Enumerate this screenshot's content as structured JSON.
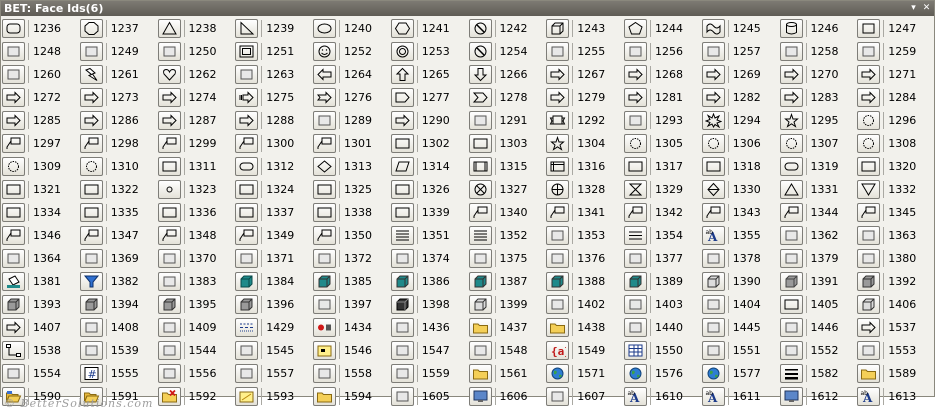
{
  "window": {
    "title": "BET: Face Ids(6)",
    "dropdown_glyph": "▾",
    "close_glyph": "✕"
  },
  "face_ids": [
    1236,
    1237,
    1238,
    1239,
    1240,
    1241,
    1242,
    1243,
    1244,
    1245,
    1246,
    1247,
    1248,
    1249,
    1250,
    1251,
    1252,
    1253,
    1254,
    1255,
    1256,
    1257,
    1258,
    1259,
    1260,
    1261,
    1262,
    1263,
    1264,
    1265,
    1266,
    1267,
    1268,
    1269,
    1270,
    1271,
    1272,
    1273,
    1274,
    1275,
    1276,
    1277,
    1278,
    1279,
    1281,
    1282,
    1283,
    1284,
    1285,
    1286,
    1287,
    1288,
    1289,
    1290,
    1291,
    1292,
    1293,
    1294,
    1295,
    1296,
    1297,
    1298,
    1299,
    1300,
    1301,
    1302,
    1303,
    1304,
    1305,
    1306,
    1307,
    1308,
    1309,
    1310,
    1311,
    1312,
    1313,
    1314,
    1315,
    1316,
    1317,
    1318,
    1319,
    1320,
    1321,
    1322,
    1323,
    1324,
    1325,
    1326,
    1327,
    1328,
    1329,
    1330,
    1331,
    1332,
    1334,
    1335,
    1336,
    1337,
    1338,
    1339,
    1340,
    1341,
    1342,
    1343,
    1344,
    1345,
    1346,
    1347,
    1348,
    1349,
    1350,
    1351,
    1352,
    1353,
    1354,
    1355,
    1362,
    1363,
    1364,
    1369,
    1370,
    1371,
    1372,
    1374,
    1375,
    1376,
    1377,
    1378,
    1379,
    1380,
    1381,
    1382,
    1383,
    1384,
    1385,
    1386,
    1387,
    1388,
    1389,
    1390,
    1391,
    1392,
    1393,
    1394,
    1395,
    1396,
    1397,
    1398,
    1399,
    1402,
    1403,
    1404,
    1405,
    1406,
    1407,
    1408,
    1409,
    1429,
    1434,
    1436,
    1437,
    1438,
    1440,
    1445,
    1446,
    1537,
    1538,
    1539,
    1544,
    1545,
    1546,
    1547,
    1548,
    1549,
    1550,
    1551,
    1552,
    1553,
    1554,
    1555,
    1556,
    1557,
    1558,
    1559,
    1561,
    1571,
    1576,
    1577,
    1582,
    1589,
    1590,
    1591,
    1592,
    1593,
    1594,
    1605,
    1606,
    1607,
    1610,
    1611,
    1612,
    1613
  ],
  "icons": [
    "rounded-rectangle",
    "octagon",
    "triangle",
    "right-triangle",
    "ellipse",
    "hexagon",
    "no-symbol",
    "cube",
    "pentagon",
    "wave",
    "can",
    "rectangle",
    "scroll",
    "folded-corner",
    "rect-bevel",
    "frame",
    "smiley",
    "donut",
    "no-symbol",
    "arc",
    "left-bracket",
    "right-bracket",
    "left-brace",
    "right-brace",
    "arc-line",
    "lightning",
    "heart",
    "frame-bevel",
    "left-arrow",
    "up-arrow",
    "down-arrow",
    "left-right-arrow",
    "up-down-arrow",
    "quad-arrow",
    "left-right-up-arrow",
    "bent-up-arrow",
    "bent-arrow",
    "u-turn-arrow",
    "left-up-arrow",
    "striped-right-arrow",
    "notched-right-arrow",
    "pentagon-arrow",
    "chevron",
    "curved-right-arrow",
    "curved-left-arrow",
    "curved-up-arrow",
    "curved-down-arrow",
    "circular-arrow",
    "right-arrow-callout",
    "left-arrow-callout",
    "down-arrow-callout",
    "up-arrow-callout",
    "left-right-callout",
    "quad-arrow-callout",
    "up-down-callout",
    "ribbon",
    "wave-ribbon",
    "explosion",
    "star",
    "seal",
    "callout-line",
    "callout-line-2",
    "callout-line-3",
    "callout-line-4",
    "callout-line-5",
    "flowchart-process",
    "flowchart-alt",
    "star-5",
    "cloud-callout",
    "seal-16",
    "seal-24",
    "cloud",
    "explosion-2",
    "explosion-3",
    "flowchart-process",
    "flowchart-terminator",
    "flowchart-decision",
    "flowchart-data",
    "flowchart-predefined",
    "flowchart-internal",
    "flowchart-document",
    "flowchart-multidoc",
    "flowchart-terminator",
    "flowchart-prep",
    "flowchart-manual-input",
    "flowchart-manual-op",
    "flowchart-connector",
    "flowchart-offpage",
    "flowchart-card",
    "flowchart-tape",
    "flowchart-junction",
    "flowchart-or",
    "flowchart-collate",
    "flowchart-sort",
    "flowchart-extract",
    "flowchart-merge",
    "flowchart-stored-data",
    "flowchart-sequential",
    "flowchart-magnetic-disk",
    "flowchart-direct-access",
    "flowchart-display",
    "flowchart-delay",
    "callout-1",
    "callout-2",
    "callout-3",
    "callout-4",
    "callout-5",
    "callout-6",
    "callout-7",
    "callout-8",
    "callout-9",
    "callout-10",
    "callout-11",
    "text-lines",
    "text-lines-2",
    "text-box-ab",
    "text-lines-3",
    "text-ab",
    "insert-item",
    "picture-frame",
    "paste-special",
    "fill-color",
    "fill-color-2",
    "line-color",
    "select-objects",
    "no-fill",
    "rotate",
    "rotate-2",
    "flip",
    "flip-2",
    "shadow",
    "frame-3d",
    "fill-bucket",
    "fill-funnel",
    "pattern-fill",
    "cube-teal",
    "cube-teal-2",
    "cube-teal-3",
    "cube-teal-4",
    "cube-teal-5",
    "cube-teal-6",
    "cube-outline",
    "cube-grey",
    "cube-grey-2",
    "cube-grey-3",
    "cube-grey-4",
    "cube-grey-5",
    "cube-grey-6",
    "pointer-color",
    "cube-black",
    "cube-wire",
    "teal-square-shape",
    "frame-3d",
    "fill-color-3",
    "flowchart-shapes",
    "cube-light",
    "shape-arrows",
    "connect-shapes",
    "fill-effects",
    "dashes",
    "record-stop",
    "lock",
    "stack-folders",
    "stack-folders-2",
    "wand",
    "picture",
    "pencil-page",
    "list-arrow",
    "connector",
    "curved-connector",
    "vertical-text",
    "dashes-2",
    "note-yellow",
    "brackets",
    "pages",
    "red-braces",
    "table-grid",
    "picture-2",
    "edit-page",
    "list-lines",
    "doc-small",
    "hash-box",
    "scroll-2",
    "route",
    "select-box",
    "lock-box",
    "folder-search",
    "globe-search",
    "globe-small",
    "globe-small-2",
    "thick-lines",
    "folder",
    "folder-open",
    "open-folder-2",
    "red-x-folder",
    "yellow-note",
    "folder-yellow",
    "pen-edit",
    "monitor-search",
    "hand-page",
    "text-a",
    "text-a-2",
    "monitor",
    "text-a-3"
  ]
}
